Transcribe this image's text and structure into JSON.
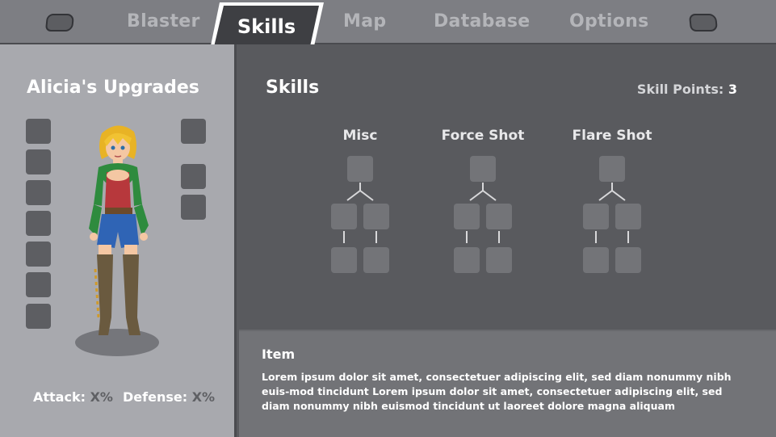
{
  "nav": {
    "tabs": [
      {
        "label": "Blaster"
      },
      {
        "label": "Skills",
        "active": true
      },
      {
        "label": "Map"
      },
      {
        "label": "Database"
      },
      {
        "label": "Options"
      }
    ],
    "shoulder_left_icon": "left-shoulder-button-icon",
    "shoulder_right_icon": "right-shoulder-button-icon"
  },
  "left_panel": {
    "title": "Alicia's Upgrades",
    "left_slot_count": 7,
    "right_slot_count": 3,
    "attack_label": "Attack:",
    "attack_value": "X%",
    "defense_label": "Defense:",
    "defense_value": "X%"
  },
  "skills": {
    "title": "Skills",
    "points_label": "Skill Points:",
    "points_value": "3",
    "trees": [
      {
        "name": "Misc"
      },
      {
        "name": "Force Shot"
      },
      {
        "name": "Flare Shot"
      }
    ]
  },
  "item": {
    "title": "Item",
    "description": "Lorem ipsum dolor sit amet, consectetuer adipiscing elit, sed diam nonummy nibh euis-mod tincidunt Lorem ipsum dolor sit amet, consectetuer adipiscing elit, sed diam nonummy nibh euismod tincidunt ut laoreet dolore magna aliquam"
  },
  "colors": {
    "topbar": "#7d7e83",
    "left_panel": "#a8a9ae",
    "main_panel": "#595a5e",
    "item_panel": "#727377",
    "slot": "#5d5e62",
    "node": "#737478"
  }
}
